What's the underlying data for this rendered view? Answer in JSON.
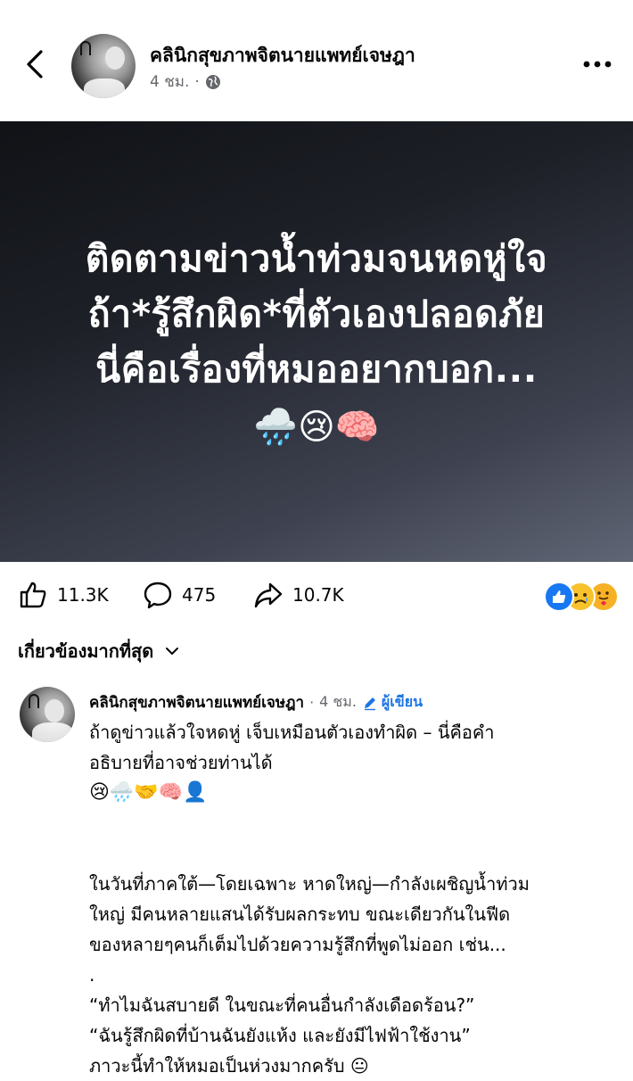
{
  "header": {
    "page_name": "คลินิกสุขภาพจิตนายแพทย์เจษฎา",
    "post_time": "4 ชม.",
    "audience_icon": "globe-icon",
    "back_icon": "chevron-left-icon",
    "more_icon": "more-horizontal-icon"
  },
  "banner": {
    "lines": [
      "ติดตามข่าวน้ำท่วมจนหดหู่ใจ",
      "ถ้า*รู้สึกผิด*ที่ตัวเองปลอดภัย",
      "นี่คือเรื่องที่หมออยากบอก..."
    ],
    "emojis": "🌧️😢🧠"
  },
  "stats": {
    "likes": "11.3K",
    "comments": "475",
    "shares": "10.7K",
    "reactions": [
      "like",
      "sad",
      "care"
    ]
  },
  "sort": {
    "label": "เกี่ยวข้องมากที่สุด"
  },
  "comment": {
    "author": "คลินิกสุขภาพจิตนายแพทย์เจษฎา",
    "separator": "·",
    "time": "4 ชม.",
    "author_badge": "ผู้เขียน",
    "lines": [
      "ถ้าดูข่าวแล้วใจหดหู่ เจ็บเหมือนตัวเองทำผิด – นี่คือคำ",
      "อธิบายที่อาจช่วยท่านได้"
    ],
    "emojis": "😢🌧️🤝🧠👤",
    "paragraph2": [
      "ในวันที่ภาคใต้—โดยเฉพาะ หาดใหญ่—กำลังเผชิญน้ำท่วม",
      "ใหญ่ มีคนหลายแสนได้รับผลกระทบ ขณะเดียวกันในฟีด",
      "ของหลายๆคนก็เต็มไปด้วยความรู้สึกที่พูดไม่ออก เช่น...",
      "."
    ],
    "paragraph3": [
      "“ทำไมฉันสบายดี ในขณะที่คนอื่นกำลังเดือดร้อน?”",
      "“ฉันรู้สึกผิดที่บ้านฉันยังแห้ง และยังมีไฟฟ้าใช้งาน”",
      "ภาวะนี้ทำให้หมอเป็นห่วงมากครับ 😐"
    ]
  }
}
